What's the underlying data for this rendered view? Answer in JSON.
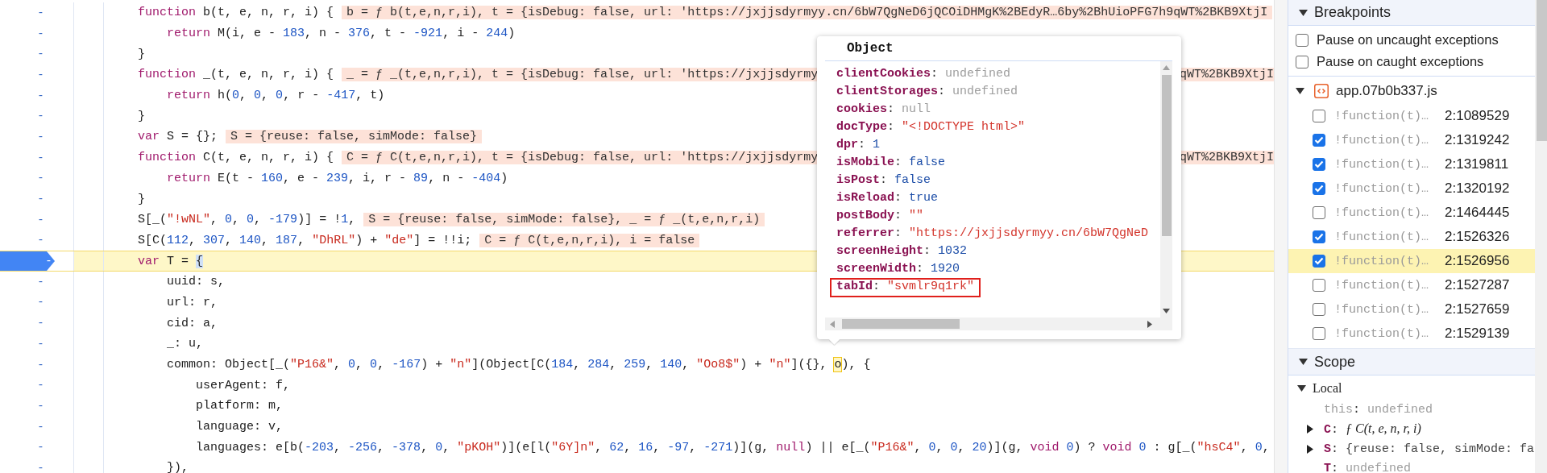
{
  "code": {
    "lines": [
      {
        "number": "-",
        "breakpoint": false,
        "current": false,
        "tokens": [
          {
            "kind": "keyword",
            "text": "    function"
          },
          {
            "kind": "plain",
            "text": " b(t, e, n, r, i) {"
          }
        ],
        "inline_values": [
          "b = ƒ b(t,e,n,r,i), t = {isDebug: false, url: 'https://jxjjsdyrmyy.cn/6bW7QgNeD6jQCOiDHMgK%2BEdyR…6by%2BhUioPFG7h9qWT%2BKB9XtjI"
        ]
      },
      {
        "number": "-",
        "breakpoint": false,
        "current": false,
        "tokens": [
          {
            "kind": "keyword",
            "text": "        return"
          },
          {
            "kind": "plain",
            "text": " M(i, e - "
          },
          {
            "kind": "number",
            "text": "183"
          },
          {
            "kind": "plain",
            "text": ", n - "
          },
          {
            "kind": "number",
            "text": "376"
          },
          {
            "kind": "plain",
            "text": ", t - "
          },
          {
            "kind": "number",
            "text": "-921"
          },
          {
            "kind": "plain",
            "text": ", i - "
          },
          {
            "kind": "number",
            "text": "244"
          },
          {
            "kind": "plain",
            "text": ")"
          }
        ]
      },
      {
        "number": "-",
        "breakpoint": false,
        "current": false,
        "tokens": [
          {
            "kind": "plain",
            "text": "    }"
          }
        ]
      },
      {
        "number": "-",
        "breakpoint": false,
        "current": false,
        "tokens": [
          {
            "kind": "keyword",
            "text": "    function"
          },
          {
            "kind": "plain",
            "text": " _(t, e, n, r, i) {"
          }
        ],
        "inline_values": [
          "_ = ƒ _(t,e,n,r,i), t = {isDebug: false, url: 'https://jxjjsdyrmy",
          "qWT%2BKB9XtjI"
        ]
      },
      {
        "number": "-",
        "breakpoint": false,
        "current": false,
        "tokens": [
          {
            "kind": "keyword",
            "text": "        return"
          },
          {
            "kind": "plain",
            "text": " h("
          },
          {
            "kind": "number",
            "text": "0"
          },
          {
            "kind": "plain",
            "text": ", "
          },
          {
            "kind": "number",
            "text": "0"
          },
          {
            "kind": "plain",
            "text": ", "
          },
          {
            "kind": "number",
            "text": "0"
          },
          {
            "kind": "plain",
            "text": ", r - "
          },
          {
            "kind": "number",
            "text": "-417"
          },
          {
            "kind": "plain",
            "text": ", t)"
          }
        ]
      },
      {
        "number": "-",
        "breakpoint": false,
        "current": false,
        "tokens": [
          {
            "kind": "plain",
            "text": "    }"
          }
        ]
      },
      {
        "number": "-",
        "breakpoint": false,
        "current": false,
        "tokens": [
          {
            "kind": "keyword",
            "text": "    var"
          },
          {
            "kind": "plain",
            "text": " S = {};"
          }
        ],
        "inline_values": [
          "S = {reuse: false, simMode: false}"
        ]
      },
      {
        "number": "-",
        "breakpoint": false,
        "current": false,
        "tokens": [
          {
            "kind": "keyword",
            "text": "    function"
          },
          {
            "kind": "plain",
            "text": " C(t, e, n, r, i) {"
          }
        ],
        "inline_values": [
          "C = ƒ C(t,e,n,r,i), t = {isDebug: false, url: 'https://jxjjsdyrmy",
          "qWT%2BKB9XtjI"
        ]
      },
      {
        "number": "-",
        "breakpoint": false,
        "current": false,
        "tokens": [
          {
            "kind": "keyword",
            "text": "        return"
          },
          {
            "kind": "plain",
            "text": " E(t - "
          },
          {
            "kind": "number",
            "text": "160"
          },
          {
            "kind": "plain",
            "text": ", e - "
          },
          {
            "kind": "number",
            "text": "239"
          },
          {
            "kind": "plain",
            "text": ", i, r - "
          },
          {
            "kind": "number",
            "text": "89"
          },
          {
            "kind": "plain",
            "text": ", n - "
          },
          {
            "kind": "number",
            "text": "-404"
          },
          {
            "kind": "plain",
            "text": ")"
          }
        ]
      },
      {
        "number": "-",
        "breakpoint": false,
        "current": false,
        "tokens": [
          {
            "kind": "plain",
            "text": "    }"
          }
        ]
      },
      {
        "number": "-",
        "breakpoint": false,
        "current": false,
        "tokens": [
          {
            "kind": "plain",
            "text": "    S[_("
          },
          {
            "kind": "string",
            "text": "\"!wNL\""
          },
          {
            "kind": "plain",
            "text": ", "
          },
          {
            "kind": "number",
            "text": "0"
          },
          {
            "kind": "plain",
            "text": ", "
          },
          {
            "kind": "number",
            "text": "0"
          },
          {
            "kind": "plain",
            "text": ", "
          },
          {
            "kind": "number",
            "text": "-179"
          },
          {
            "kind": "plain",
            "text": ")] = !"
          },
          {
            "kind": "number",
            "text": "1"
          },
          {
            "kind": "plain",
            "text": ","
          }
        ],
        "inline_values": [
          "S = {reuse: false, simMode: false}, _ = ƒ _(t,e,n,r,i)"
        ]
      },
      {
        "number": "-",
        "breakpoint": false,
        "current": false,
        "tokens": [
          {
            "kind": "plain",
            "text": "    S[C("
          },
          {
            "kind": "number",
            "text": "112"
          },
          {
            "kind": "plain",
            "text": ", "
          },
          {
            "kind": "number",
            "text": "307"
          },
          {
            "kind": "plain",
            "text": ", "
          },
          {
            "kind": "number",
            "text": "140"
          },
          {
            "kind": "plain",
            "text": ", "
          },
          {
            "kind": "number",
            "text": "187"
          },
          {
            "kind": "plain",
            "text": ", "
          },
          {
            "kind": "string",
            "text": "\"DhRL\""
          },
          {
            "kind": "plain",
            "text": ") + "
          },
          {
            "kind": "string",
            "text": "\"de\""
          },
          {
            "kind": "plain",
            "text": "] = !!i;"
          }
        ],
        "inline_values": [
          "C = ƒ C(t,e,n,r,i), i = false"
        ]
      },
      {
        "number": "-",
        "breakpoint": true,
        "current": true,
        "tokens": [
          {
            "kind": "keyword",
            "text": "    var"
          },
          {
            "kind": "plain",
            "text": " T = "
          },
          {
            "kind": "bracket-match",
            "text": "{"
          }
        ]
      },
      {
        "number": "-",
        "breakpoint": false,
        "current": false,
        "tokens": [
          {
            "kind": "plain",
            "text": "        uuid: s,"
          }
        ]
      },
      {
        "number": "-",
        "breakpoint": false,
        "current": false,
        "tokens": [
          {
            "kind": "plain",
            "text": "        url: r,"
          }
        ]
      },
      {
        "number": "-",
        "breakpoint": false,
        "current": false,
        "tokens": [
          {
            "kind": "plain",
            "text": "        cid: a,"
          }
        ]
      },
      {
        "number": "-",
        "breakpoint": false,
        "current": false,
        "tokens": [
          {
            "kind": "plain",
            "text": "        _: u,"
          }
        ]
      },
      {
        "number": "-",
        "breakpoint": false,
        "current": false,
        "tokens": [
          {
            "kind": "plain",
            "text": "        common: Object[_("
          },
          {
            "kind": "string",
            "text": "\"P16&\""
          },
          {
            "kind": "plain",
            "text": ", "
          },
          {
            "kind": "number",
            "text": "0"
          },
          {
            "kind": "plain",
            "text": ", "
          },
          {
            "kind": "number",
            "text": "0"
          },
          {
            "kind": "plain",
            "text": ", "
          },
          {
            "kind": "number",
            "text": "-167"
          },
          {
            "kind": "plain",
            "text": ") + "
          },
          {
            "kind": "string",
            "text": "\"n\""
          },
          {
            "kind": "plain",
            "text": "](Object[C("
          },
          {
            "kind": "number",
            "text": "184"
          },
          {
            "kind": "plain",
            "text": ", "
          },
          {
            "kind": "number",
            "text": "284"
          },
          {
            "kind": "plain",
            "text": ", "
          },
          {
            "kind": "number",
            "text": "259"
          },
          {
            "kind": "plain",
            "text": ", "
          },
          {
            "kind": "number",
            "text": "140"
          },
          {
            "kind": "plain",
            "text": ", "
          },
          {
            "kind": "string",
            "text": "\"Oo8$\""
          },
          {
            "kind": "plain",
            "text": ") + "
          },
          {
            "kind": "string",
            "text": "\"n\""
          },
          {
            "kind": "plain",
            "text": "]({}, "
          },
          {
            "kind": "hover-target",
            "text": "o"
          },
          {
            "kind": "plain",
            "text": "), {"
          }
        ]
      },
      {
        "number": "-",
        "breakpoint": false,
        "current": false,
        "tokens": [
          {
            "kind": "plain",
            "text": "            userAgent: f,"
          }
        ]
      },
      {
        "number": "-",
        "breakpoint": false,
        "current": false,
        "tokens": [
          {
            "kind": "plain",
            "text": "            platform: m,"
          }
        ]
      },
      {
        "number": "-",
        "breakpoint": false,
        "current": false,
        "tokens": [
          {
            "kind": "plain",
            "text": "            language: v,"
          }
        ]
      },
      {
        "number": "-",
        "breakpoint": false,
        "current": false,
        "tokens": [
          {
            "kind": "plain",
            "text": "            languages: e[b("
          },
          {
            "kind": "number",
            "text": "-203"
          },
          {
            "kind": "plain",
            "text": ", "
          },
          {
            "kind": "number",
            "text": "-256"
          },
          {
            "kind": "plain",
            "text": ", "
          },
          {
            "kind": "number",
            "text": "-378"
          },
          {
            "kind": "plain",
            "text": ", "
          },
          {
            "kind": "number",
            "text": "0"
          },
          {
            "kind": "plain",
            "text": ", "
          },
          {
            "kind": "string",
            "text": "\"pKOH\""
          },
          {
            "kind": "plain",
            "text": ")](e[l("
          },
          {
            "kind": "string",
            "text": "\"6Y]n\""
          },
          {
            "kind": "plain",
            "text": ", "
          },
          {
            "kind": "number",
            "text": "62"
          },
          {
            "kind": "plain",
            "text": ", "
          },
          {
            "kind": "number",
            "text": "16"
          },
          {
            "kind": "plain",
            "text": ", "
          },
          {
            "kind": "number",
            "text": "-97"
          },
          {
            "kind": "plain",
            "text": ", "
          },
          {
            "kind": "number",
            "text": "-271"
          },
          {
            "kind": "plain",
            "text": ")](g, "
          },
          {
            "kind": "keyword",
            "text": "null"
          },
          {
            "kind": "plain",
            "text": ") || e[_("
          },
          {
            "kind": "string",
            "text": "\"P16&\""
          },
          {
            "kind": "plain",
            "text": ", "
          },
          {
            "kind": "number",
            "text": "0"
          },
          {
            "kind": "plain",
            "text": ", "
          },
          {
            "kind": "number",
            "text": "0"
          },
          {
            "kind": "plain",
            "text": ", "
          },
          {
            "kind": "number",
            "text": "20"
          },
          {
            "kind": "plain",
            "text": ")](g, "
          },
          {
            "kind": "keyword",
            "text": "void"
          },
          {
            "kind": "number",
            "text": " 0"
          },
          {
            "kind": "plain",
            "text": ") ? "
          },
          {
            "kind": "keyword",
            "text": "void"
          },
          {
            "kind": "number",
            "text": " 0"
          },
          {
            "kind": "plain",
            "text": " : g[_("
          },
          {
            "kind": "string",
            "text": "\"hsC4\""
          },
          {
            "kind": "plain",
            "text": ", "
          },
          {
            "kind": "number",
            "text": "0"
          },
          {
            "kind": "plain",
            "text": ","
          }
        ]
      },
      {
        "number": "-",
        "breakpoint": false,
        "current": false,
        "tokens": [
          {
            "kind": "plain",
            "text": "        }),"
          }
        ]
      }
    ]
  },
  "popover": {
    "title": "Object",
    "properties": [
      {
        "key": "clientCookies",
        "separator": ":",
        "value": "undefined",
        "kind": "undefined",
        "outlined": false
      },
      {
        "key": "clientStorages",
        "separator": ":",
        "value": "undefined",
        "kind": "undefined",
        "outlined": false
      },
      {
        "key": "cookies",
        "separator": ":",
        "value": "null",
        "kind": "null",
        "outlined": false
      },
      {
        "key": "docType",
        "separator": ":",
        "value": "\"<!DOCTYPE html>\"",
        "kind": "string",
        "outlined": false
      },
      {
        "key": "dpr",
        "separator": ":",
        "value": "1",
        "kind": "number",
        "outlined": false
      },
      {
        "key": "isMobile",
        "separator": ":",
        "value": "false",
        "kind": "boolean",
        "outlined": false
      },
      {
        "key": "isPost",
        "separator": ":",
        "value": "false",
        "kind": "boolean",
        "outlined": false
      },
      {
        "key": "isReload",
        "separator": ":",
        "value": "true",
        "kind": "boolean",
        "outlined": false
      },
      {
        "key": "postBody",
        "separator": ":",
        "value": "\"\"",
        "kind": "string",
        "outlined": false
      },
      {
        "key": "referrer",
        "separator": ":",
        "value": "\"https://jxjjsdyrmyy.cn/6bW7QgNeD",
        "kind": "string",
        "outlined": false
      },
      {
        "key": "screenHeight",
        "separator": ":",
        "value": "1032",
        "kind": "number",
        "outlined": false
      },
      {
        "key": "screenWidth",
        "separator": ":",
        "value": "1920",
        "kind": "number",
        "outlined": false
      },
      {
        "key": "tabId",
        "separator": ":",
        "value": "\"svmlr9q1rk\"",
        "kind": "string",
        "outlined": true
      }
    ]
  },
  "breakpoints": {
    "title": "Breakpoints",
    "expanded": true,
    "options": [
      {
        "label": "Pause on uncaught exceptions",
        "checked": false
      },
      {
        "label": "Pause on caught exceptions",
        "checked": false
      }
    ],
    "files": [
      {
        "name": "app.07b0b337.js",
        "expanded": true,
        "items": [
          {
            "code": "!function(t)…",
            "location": "2:1089529",
            "checked": false,
            "current": false
          },
          {
            "code": "!function(t)…",
            "location": "2:1319242",
            "checked": true,
            "current": false
          },
          {
            "code": "!function(t)…",
            "location": "2:1319811",
            "checked": true,
            "current": false
          },
          {
            "code": "!function(t)…",
            "location": "2:1320192",
            "checked": true,
            "current": false
          },
          {
            "code": "!function(t)…",
            "location": "2:1464445",
            "checked": false,
            "current": false
          },
          {
            "code": "!function(t)…",
            "location": "2:1526326",
            "checked": true,
            "current": false
          },
          {
            "code": "!function(t)…",
            "location": "2:1526956",
            "checked": true,
            "current": true
          },
          {
            "code": "!function(t)…",
            "location": "2:1527287",
            "checked": false,
            "current": false
          },
          {
            "code": "!function(t)…",
            "location": "2:1527659",
            "checked": false,
            "current": false
          },
          {
            "code": "!function(t)…",
            "location": "2:1529139",
            "checked": false,
            "current": false
          }
        ]
      }
    ]
  },
  "scope": {
    "title": "Scope",
    "expanded": true,
    "groups": [
      {
        "name": "Local",
        "expanded": true,
        "entries": [
          {
            "key": "this",
            "separator": ":",
            "value": "undefined",
            "kind": "undefined",
            "expandable": false,
            "dimmed": true
          },
          {
            "key": "C",
            "separator": ":",
            "value": "ƒ C(t, e, n, r, i)",
            "kind": "function",
            "expandable": true,
            "dimmed": false
          },
          {
            "key": "S",
            "separator": ":",
            "value": "{reuse: false, simMode: fa",
            "kind": "object",
            "expandable": true,
            "dimmed": false
          },
          {
            "key": "T",
            "separator": ":",
            "value": "undefined",
            "kind": "undefined",
            "expandable": false,
            "dimmed": false
          }
        ]
      }
    ]
  }
}
